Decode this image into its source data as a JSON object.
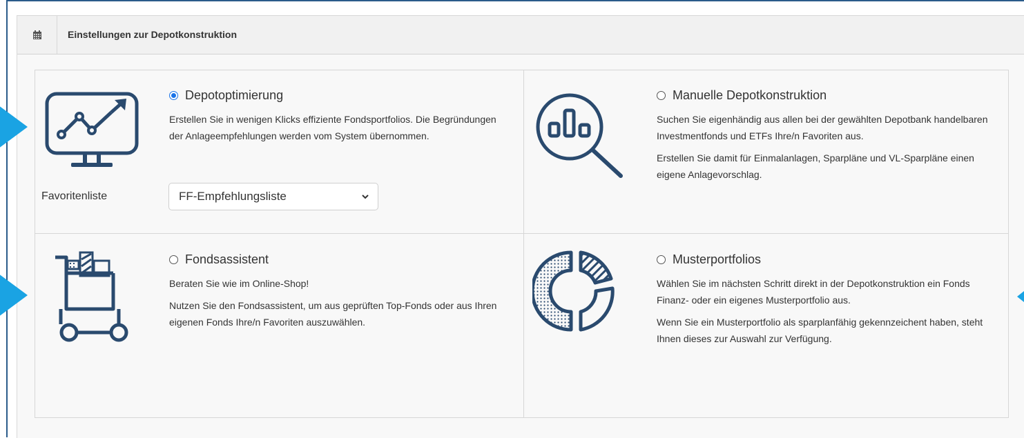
{
  "header": {
    "title": "Einstellungen zur Depotkonstruktion",
    "icon": "calendar-icon"
  },
  "options": {
    "depotoptimierung": {
      "label": "Depotoptimierung",
      "checked": true,
      "icon": "chart-monitor-icon",
      "desc": [
        "Erstellen Sie in wenigen Klicks effiziente Fondsportfolios. Die Begründungen der Anlageempfehlungen werden vom System übernommen."
      ],
      "favorites_label": "Favoritenliste",
      "favorites_value": "FF-Empfehlungsliste"
    },
    "manuelle": {
      "label": "Manuelle Depotkonstruktion",
      "checked": false,
      "icon": "magnifier-chart-icon",
      "desc": [
        "Suchen Sie eigenhändig aus allen bei der gewählten Depotbank handelbaren Investmentfonds und ETFs Ihre/n Favoriten aus.",
        "Erstellen Sie damit für Einmalanlagen, Sparpläne und VL-Sparpläne einen eigene Anlagevorschlag."
      ]
    },
    "fondsassistent": {
      "label": "Fondsassistent",
      "checked": false,
      "icon": "shopping-cart-icon",
      "desc": [
        "Beraten Sie wie im Online-Shop!",
        "Nutzen Sie den Fondsassistent, um aus geprüften Top-Fonds oder aus Ihren eigenen Fonds Ihre/n Favoriten auszuwählen."
      ]
    },
    "musterportfolios": {
      "label": "Musterportfolios",
      "checked": false,
      "icon": "donut-chart-icon",
      "desc": [
        "Wählen Sie im nächsten Schritt direkt in der Depotkonstruktion ein Fonds Finanz- oder ein eigenes Musterportfolio aus.",
        "Wenn Sie ein Musterportfolio als sparplanfähig gekennzeichent haben, steht Ihnen dieses zur Auswahl zur Verfügung."
      ]
    }
  },
  "colors": {
    "icon": "#2a4a6e",
    "accent": "#1aa3e3",
    "radio_checked": "#1a73e8"
  }
}
